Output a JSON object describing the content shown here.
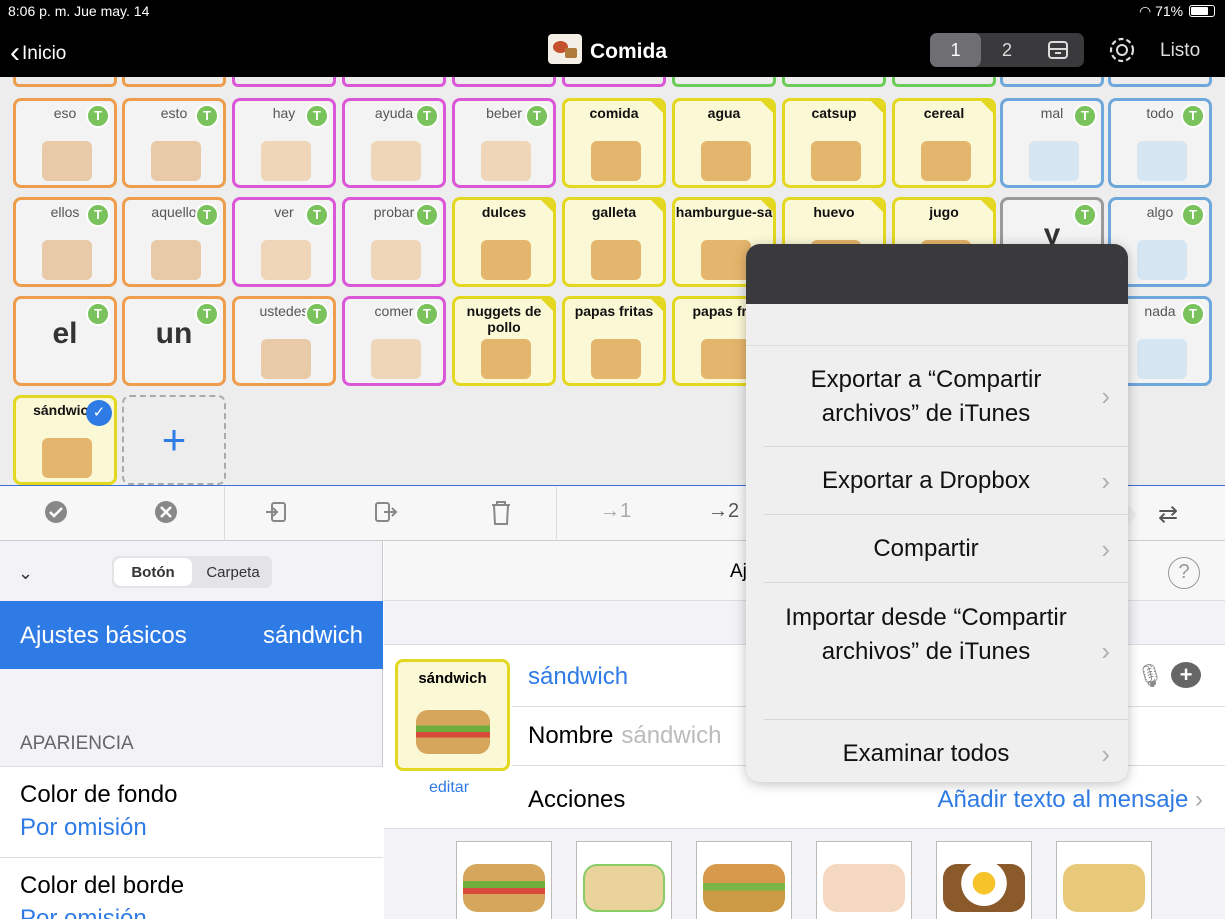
{
  "status": {
    "time": "8:06 p. m.  Jue may. 14",
    "right": "71%"
  },
  "nav": {
    "back": "Inicio",
    "title": "Comida",
    "seg": [
      "1",
      "2"
    ],
    "done": "Listo"
  },
  "tiles": [
    {
      "label": "eso",
      "badge": "T"
    },
    {
      "label": "esto",
      "badge": "T"
    },
    {
      "label": "hay",
      "badge": "T"
    },
    {
      "label": "ayuda",
      "badge": "T"
    },
    {
      "label": "beber",
      "badge": "T"
    },
    {
      "label": "comida"
    },
    {
      "label": "agua"
    },
    {
      "label": "catsup"
    },
    {
      "label": "cereal"
    },
    {
      "label": "mal",
      "badge": "T"
    },
    {
      "label": "todo",
      "badge": "T"
    },
    {
      "label": "ellos",
      "badge": "T"
    },
    {
      "label": "aquello",
      "badge": "T"
    },
    {
      "label": "ver",
      "badge": "T"
    },
    {
      "label": "probar",
      "badge": "T"
    },
    {
      "label": "dulces"
    },
    {
      "label": "galleta"
    },
    {
      "label": "hamburgue-sa"
    },
    {
      "label": "huevo"
    },
    {
      "label": "jugo"
    },
    {
      "label": "y",
      "badge": "T"
    },
    {
      "label": "algo",
      "badge": "T"
    },
    {
      "label": "el",
      "badge": "T"
    },
    {
      "label": "un",
      "badge": "T"
    },
    {
      "label": "ustedes",
      "badge": "T"
    },
    {
      "label": "comer",
      "badge": "T"
    },
    {
      "label": "nuggets de pollo"
    },
    {
      "label": "papas fritas"
    },
    {
      "label": "papas frit"
    },
    {
      "label": "nada",
      "badge": "T"
    },
    {
      "label": "sándwich"
    }
  ],
  "add_label": "+",
  "toolbar": {
    "move1": "→1",
    "move2": "→2",
    "swap": "⇄"
  },
  "left": {
    "seg": [
      "Botón",
      "Carpeta"
    ],
    "basic": "Ajustes básicos",
    "basic_value": "sándwich",
    "section": "APARIENCIA",
    "bg_label": "Color de fondo",
    "bg_value": "Por omisión",
    "border_label": "Color del borde",
    "border_value": "Por omisión"
  },
  "right": {
    "header": "Aj",
    "help": "?",
    "thumb_label": "sándwich",
    "edit": "editar",
    "word": "sándwich",
    "name_label": "Nombre",
    "name_placeholder": "sándwich",
    "actions_label": "Acciones",
    "actions_value": "Añadir texto al mensaje"
  },
  "popover": {
    "items": [
      "Exportar a “Compartir archivos” de iTunes",
      "Exportar a Dropbox",
      "Compartir",
      "Importar desde “Compartir archivos” de iTunes",
      "Examinar todos"
    ]
  },
  "colors": {
    "accent": "#2f7be5",
    "badge": "#79c25c"
  }
}
